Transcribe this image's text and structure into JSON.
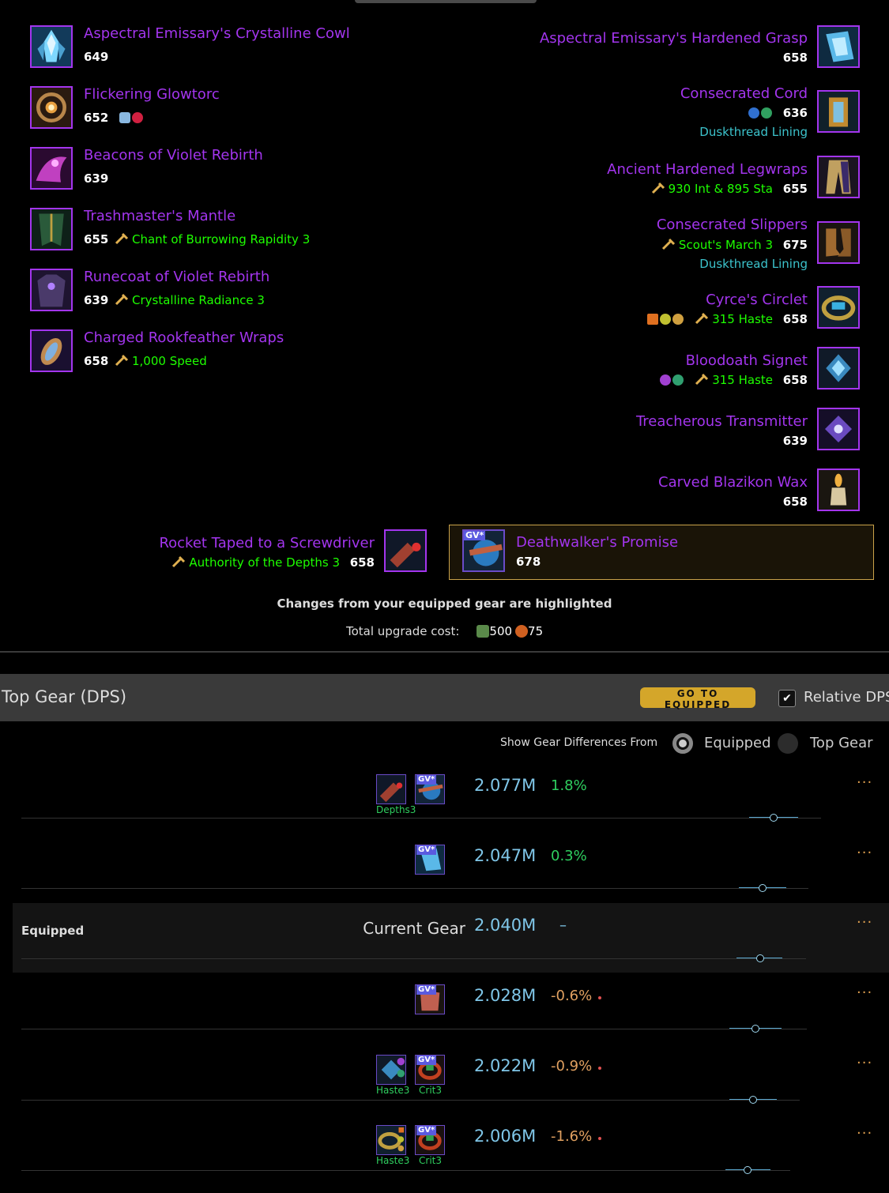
{
  "left_items": [
    {
      "name": "Aspectral Emissary's Crystalline Cowl",
      "ilvl": "649",
      "enchant": "",
      "gems": 0,
      "icon": "crystalline-cowl-icon"
    },
    {
      "name": "Flickering Glowtorc",
      "ilvl": "652",
      "enchant": "",
      "gems": 2,
      "icon": "glowtorc-icon"
    },
    {
      "name": "Beacons of Violet Rebirth",
      "ilvl": "639",
      "enchant": "",
      "gems": 0,
      "icon": "shoulder-icon"
    },
    {
      "name": "Trashmaster's Mantle",
      "ilvl": "655",
      "enchant": "Chant of Burrowing Rapidity 3",
      "gems": 0,
      "icon": "cloak-icon"
    },
    {
      "name": "Runecoat of Violet Rebirth",
      "ilvl": "639",
      "enchant": "Crystalline Radiance 3",
      "gems": 0,
      "icon": "chest-icon"
    },
    {
      "name": "Charged Rookfeather Wraps",
      "ilvl": "658",
      "enchant": "1,000 Speed",
      "gems": 0,
      "icon": "wrist-icon"
    }
  ],
  "right_items": [
    {
      "name": "Aspectral Emissary's Hardened Grasp",
      "ilvl": "658",
      "enchant": "",
      "extra": "",
      "icon": "hands-icon"
    },
    {
      "name": "Consecrated Cord",
      "ilvl": "636",
      "enchant": "",
      "extra": "Duskthread Lining",
      "icon": "belt-icon"
    },
    {
      "name": "Ancient Hardened Legwraps",
      "ilvl": "655",
      "enchant": "930 Int & 895 Sta",
      "extra": "",
      "icon": "legs-icon"
    },
    {
      "name": "Consecrated Slippers",
      "ilvl": "675",
      "enchant": "Scout's March 3",
      "extra": "Duskthread Lining",
      "icon": "boots-icon"
    },
    {
      "name": "Cyrce's Circlet",
      "ilvl": "658",
      "enchant": "315 Haste",
      "extra": "",
      "icon": "ring-icon"
    },
    {
      "name": "Bloodoath Signet",
      "ilvl": "658",
      "enchant": "315 Haste",
      "extra": "",
      "icon": "signet-icon"
    },
    {
      "name": "Treacherous Transmitter",
      "ilvl": "639",
      "enchant": "",
      "extra": "",
      "icon": "trinket-icon"
    },
    {
      "name": "Carved Blazikon Wax",
      "ilvl": "658",
      "enchant": "",
      "extra": "",
      "icon": "candle-icon"
    }
  ],
  "weapon": {
    "name": "Rocket Taped to a Screwdriver",
    "ilvl": "658",
    "enchant": "Authority of the Depths 3"
  },
  "upgrade": {
    "name": "Deathwalker's Promise",
    "ilvl": "678",
    "badge": "GV*"
  },
  "changes_caption": "Changes from your equipped gear are highlighted",
  "cost": {
    "label": "Total upgrade cost:",
    "a": "500",
    "b": "75"
  },
  "topgear": {
    "title": "Top Gear (DPS)",
    "goto_label": "GO TO EQUIPPED",
    "relative_label": "Relative DPS",
    "relative_checked": "✔",
    "diff_label": "Show Gear Differences From",
    "opt_equipped": "Equipped",
    "opt_topgear": "Top Gear"
  },
  "rows": [
    {
      "dps": "2.077M",
      "pct": "1.8%",
      "label": "",
      "name": "",
      "tags": [
        "Depths3",
        ""
      ],
      "more": "···"
    },
    {
      "dps": "2.047M",
      "pct": "0.3%",
      "label": "",
      "name": "",
      "tags": [],
      "more": "···"
    },
    {
      "dps": "2.040M",
      "pct": "–",
      "label": "Equipped",
      "name": "Current Gear",
      "tags": [],
      "more": "···"
    },
    {
      "dps": "2.028M",
      "pct": "-0.6%",
      "label": "",
      "name": "",
      "tags": [],
      "more": "···"
    },
    {
      "dps": "2.022M",
      "pct": "-0.9%",
      "label": "",
      "name": "",
      "tags": [
        "Haste3",
        "Crit3"
      ],
      "more": "···"
    },
    {
      "dps": "2.006M",
      "pct": "-1.6%",
      "label": "",
      "name": "",
      "tags": [
        "Haste3",
        "Crit3"
      ],
      "more": "···"
    }
  ],
  "colors": {
    "epic": "#a335ee",
    "enchant": "#1eff00",
    "lining": "#3cc3cc",
    "dps": "#7fc6e8",
    "accent": "#d4a62a"
  }
}
